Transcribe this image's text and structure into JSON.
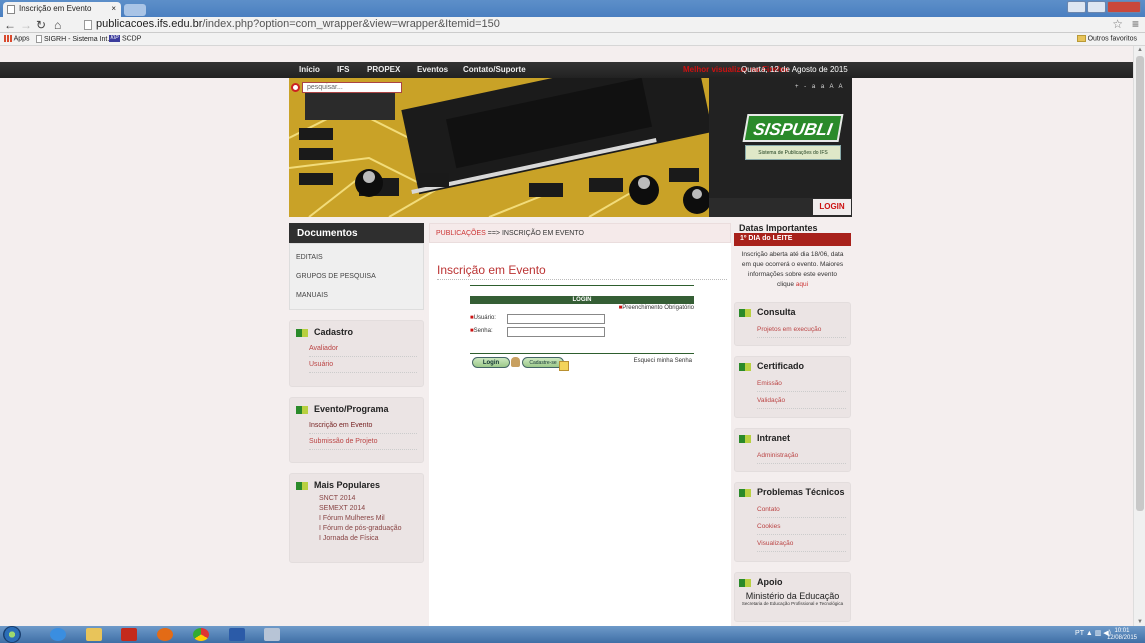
{
  "browser": {
    "tab_title": "Inscrição em Evento",
    "tab_close": "×",
    "url_host": "publicacoes.ifs.edu.br",
    "url_path": "/index.php?option=com_wrapper&view=wrapper&Itemid=150",
    "bookmarks": [
      "Apps",
      "SIGRH - Sistema Int...",
      "SCDP"
    ],
    "kip_label": "KIP",
    "other_bookmarks": "Outros favoritos"
  },
  "topnav": {
    "items": [
      "Início",
      "IFS",
      "PROPEX",
      "Eventos",
      "Contato/Suporte"
    ],
    "red_text": "Melhor visualizar no Firefox",
    "date": "Quarta, 12 de Agosto de 2015"
  },
  "banner": {
    "search_placeholder": "pesquisar...",
    "font_tools": "+ - a a A A",
    "logo_title": "SISPUBLI",
    "logo_subtitle": "Sistema de Publicações do IFS",
    "login": "LOGIN"
  },
  "left": {
    "docs_title": "Documentos",
    "docs_items": [
      "EDITAIS",
      "GRUPOS DE PESQUISA",
      "MANUAIS"
    ],
    "cadastro_title": "Cadastro",
    "cadastro_items": [
      "Avaliador",
      "Usuário"
    ],
    "evento_title": "Evento/Programa",
    "evento_items": [
      "Inscrição em Evento",
      "Submissão de Projeto"
    ],
    "popular_title": "Mais Populares",
    "popular_items": [
      "SNCT 2014",
      "SEMEXT 2014",
      "I Fórum Mulheres Mil",
      "I Fórum de pós-graduação",
      "I Jornada de Física"
    ]
  },
  "center": {
    "crumb_root": "PUBLICAÇÕES",
    "crumb_sep": " ==> ",
    "crumb_current": "INSCRIÇÃO EM EVENTO",
    "page_title": "Inscrição em Evento",
    "login_header": "LOGIN",
    "required_note": "Preenchimento Obrigatório",
    "user_label": "Usuário:",
    "pass_label": "Senha:",
    "login_btn": "Login",
    "register_btn": "Cadastre-se",
    "forgot": "Esqueci minha Senha"
  },
  "right": {
    "dates_title": "Datas Importantes",
    "dates_band": "1º DIA do LEITE",
    "dates_text": "Inscrição aberta até dia 18/06, data em que ocorrerá o evento. Maiores informações sobre este evento clique",
    "dates_link": "aqui",
    "consulta_title": "Consulta",
    "consulta_items": [
      "Projetos em execução"
    ],
    "cert_title": "Certificado",
    "cert_items": [
      "Emissão",
      "Validação"
    ],
    "intranet_title": "Intranet",
    "intranet_items": [
      "Administração"
    ],
    "prob_title": "Problemas Técnicos",
    "prob_items": [
      "Contato",
      "Cookies",
      "Visualização"
    ],
    "apoio_title": "Apoio",
    "mec_title": "Ministério da Educação",
    "mec_sub": "Secretaria de Educação Profissional e Tecnológica"
  },
  "taskbar": {
    "lang": "PT",
    "time": "10:01",
    "date": "12/08/2015"
  },
  "colors": {
    "accent_red": "#c11111",
    "green": "#2a8a2a",
    "dark": "#2f2f2f"
  }
}
